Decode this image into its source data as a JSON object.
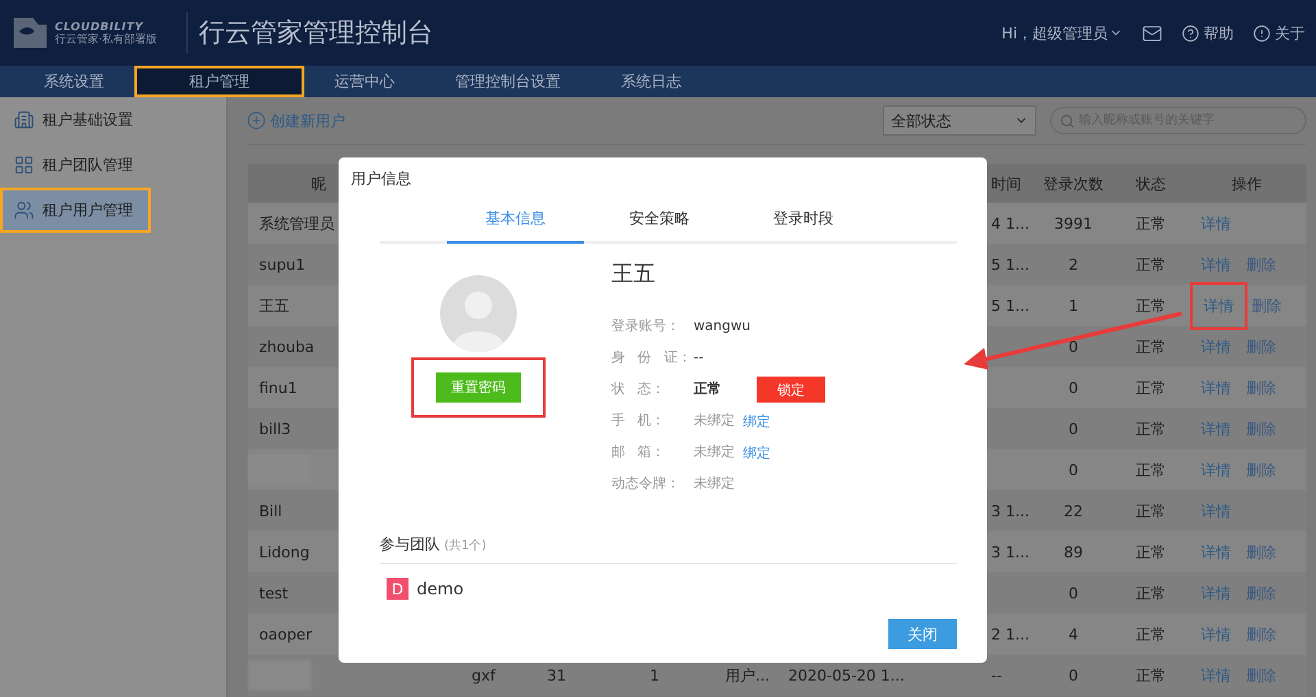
{
  "header": {
    "brand": "CLOUDBILITY",
    "brand_subtitle": "行云管家·私有部署版",
    "title": "行云管家管理控制台",
    "greeting": "Hi，超级管理员",
    "links": [
      {
        "kind": "help",
        "label": "帮助"
      },
      {
        "kind": "about",
        "label": "关于"
      }
    ]
  },
  "nav": [
    {
      "label": "系统设置",
      "selected": false,
      "highlighted": false
    },
    {
      "label": "租户管理",
      "selected": true,
      "highlighted": true
    },
    {
      "label": "运营中心",
      "selected": false,
      "highlighted": false
    },
    {
      "label": "管理控制台设置",
      "selected": false,
      "highlighted": false
    },
    {
      "label": "系统日志",
      "selected": false,
      "highlighted": false
    }
  ],
  "sidebar": {
    "items": [
      {
        "kind": "building",
        "label": "租户基础设置",
        "selected": false,
        "highlighted": false
      },
      {
        "kind": "grid",
        "label": "租户团队管理",
        "selected": false,
        "highlighted": false
      },
      {
        "kind": "users",
        "label": "租户用户管理",
        "selected": true,
        "highlighted": true
      }
    ]
  },
  "toolbar": {
    "create_label": "创建新用户",
    "status_filter": "全部状态",
    "search": {
      "placeholder": "输入昵称或账号的关键字"
    }
  },
  "table": {
    "headers": {
      "name": "昵",
      "column_7": "时间",
      "login_count": "登录次数",
      "status": "状态",
      "actions": "操作"
    },
    "rows": [
      {
        "name": "系统管理员",
        "column_7": "4 1...",
        "login_count": "3991",
        "status": "正常",
        "actions": [
          {
            "label": "详情",
            "highlighted": false
          }
        ]
      },
      {
        "name": "supu1",
        "column_7": "5 1...",
        "login_count": "2",
        "status": "正常",
        "actions": [
          {
            "label": "详情",
            "highlighted": false
          },
          {
            "label": "删除",
            "highlighted": false
          }
        ]
      },
      {
        "name": "王五",
        "column_7": "5 1...",
        "login_count": "1",
        "status": "正常",
        "actions": [
          {
            "label": "详情",
            "highlighted": true
          },
          {
            "label": "删除",
            "highlighted": false
          }
        ]
      },
      {
        "name": "zhouba",
        "login_count": "0",
        "status": "正常",
        "actions": [
          {
            "label": "详情",
            "highlighted": false
          },
          {
            "label": "删除",
            "highlighted": false
          }
        ]
      },
      {
        "name": "finu1",
        "login_count": "0",
        "status": "正常",
        "actions": [
          {
            "label": "详情",
            "highlighted": false
          },
          {
            "label": "删除",
            "highlighted": false
          }
        ]
      },
      {
        "name": "bill3",
        "login_count": "0",
        "status": "正常",
        "actions": [
          {
            "label": "详情",
            "highlighted": false
          },
          {
            "label": "删除",
            "highlighted": false
          }
        ]
      },
      {
        "login_count": "0",
        "status": "正常",
        "actions": [
          {
            "label": "详情",
            "highlighted": false
          },
          {
            "label": "删除",
            "highlighted": false
          }
        ]
      },
      {
        "name": "Bill",
        "column_7": "3 1...",
        "login_count": "22",
        "status": "正常",
        "actions": [
          {
            "label": "详情",
            "highlighted": false
          }
        ]
      },
      {
        "name": "Lidong",
        "column_7": "3 1...",
        "login_count": "89",
        "status": "正常",
        "actions": [
          {
            "label": "详情",
            "highlighted": false
          },
          {
            "label": "删除",
            "highlighted": false
          }
        ]
      },
      {
        "name": "test",
        "login_count": "0",
        "status": "正常",
        "actions": [
          {
            "label": "详情",
            "highlighted": false
          },
          {
            "label": "删除",
            "highlighted": false
          }
        ]
      },
      {
        "name": "oaoper",
        "column_7": "2 1...",
        "login_count": "4",
        "status": "正常",
        "actions": [
          {
            "label": "详情",
            "highlighted": false
          },
          {
            "label": "删除",
            "highlighted": false
          }
        ]
      },
      {
        "column_2": "gxf",
        "column_3": "31",
        "column_4": "1",
        "column_5": "用户...",
        "column_6": "2020-05-20 1...",
        "column_7": "--",
        "login_count": "0",
        "status": "正常",
        "actions": [
          {
            "label": "详情",
            "highlighted": false
          },
          {
            "label": "删除",
            "highlighted": false
          }
        ]
      }
    ]
  },
  "dialog": {
    "title": "用户信息",
    "tabs": [
      {
        "label": "基本信息",
        "selected": true
      },
      {
        "label": "安全策略",
        "selected": false
      },
      {
        "label": "登录时段",
        "selected": false
      }
    ],
    "reset_button": {
      "label": "重置密码",
      "highlighted": true
    },
    "user_name": "王五",
    "fields": [
      {
        "label": "登录账号：",
        "value": "wangwu",
        "kind": "text"
      },
      {
        "label": "身 份 证：",
        "value": "--",
        "kind": "text"
      },
      {
        "label": "状 态：",
        "value": "正常",
        "kind": "status",
        "action": "锁定"
      },
      {
        "label": "手 机：",
        "value": "未绑定",
        "kind": "bind",
        "action": "绑定"
      },
      {
        "label": "邮 箱：",
        "value": "未绑定",
        "kind": "bind",
        "action": "绑定"
      },
      {
        "label": "动态令牌：",
        "value": "未绑定",
        "kind": "muted"
      }
    ],
    "teams_title": "参与团队",
    "teams_count": "(共1个)",
    "teams": [
      {
        "initial": "D",
        "name": "demo",
        "color": "#f0506e"
      }
    ],
    "close_label": "关闭"
  }
}
